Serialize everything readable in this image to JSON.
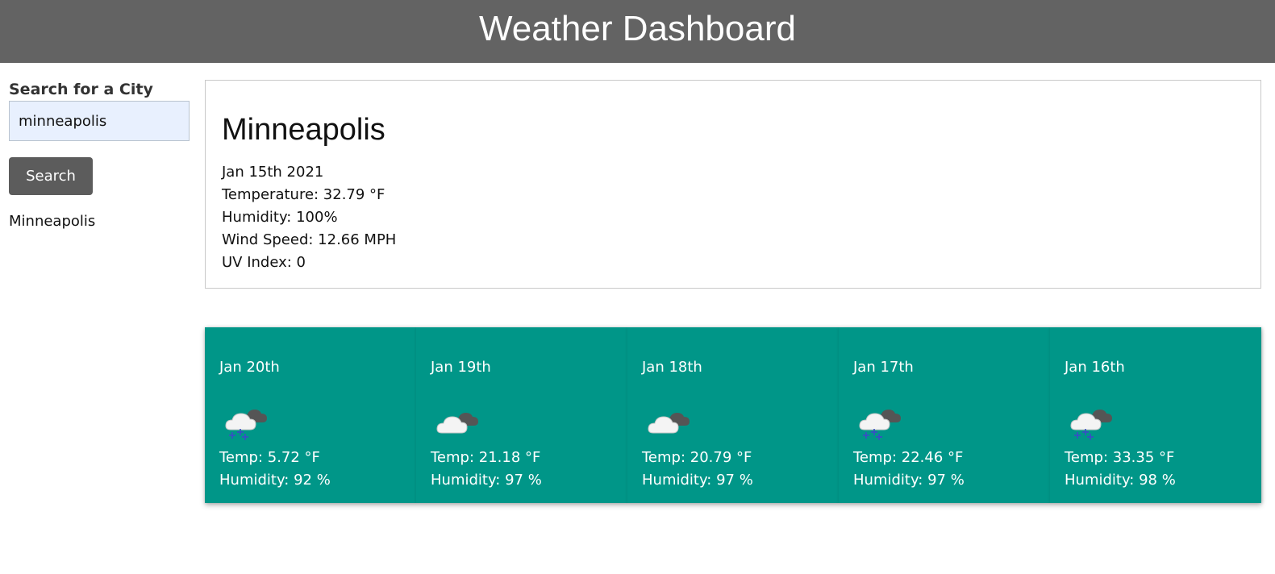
{
  "header": {
    "title": "Weather Dashboard"
  },
  "sidebar": {
    "search_label": "Search for a City",
    "search_value": "minneapolis",
    "search_button": "Search",
    "history": [
      "Minneapolis"
    ]
  },
  "current": {
    "city": "Minneapolis",
    "date": "Jan 15th 2021",
    "temperature": "Temperature: 32.79 °F",
    "humidity": "Humidity: 100%",
    "wind": "Wind Speed: 12.66 MPH",
    "uv": "UV Index: 0"
  },
  "forecast": [
    {
      "date": "Jan 20th",
      "icon": "snow-cloud-icon",
      "temp": "Temp: 5.72 °F",
      "humidity": "Humidity: 92 %"
    },
    {
      "date": "Jan 19th",
      "icon": "broken-clouds-icon",
      "temp": "Temp: 21.18 °F",
      "humidity": "Humidity: 97 %"
    },
    {
      "date": "Jan 18th",
      "icon": "broken-clouds-icon",
      "temp": "Temp: 20.79 °F",
      "humidity": "Humidity: 97 %"
    },
    {
      "date": "Jan 17th",
      "icon": "snow-cloud-icon",
      "temp": "Temp: 22.46 °F",
      "humidity": "Humidity: 97 %"
    },
    {
      "date": "Jan 16th",
      "icon": "snow-cloud-icon",
      "temp": "Temp: 33.35 °F",
      "humidity": "Humidity: 98 %"
    }
  ],
  "colors": {
    "header_bg": "#636363",
    "forecast_bg": "#009688",
    "button_bg": "#5c5c5c",
    "input_bg": "#e8f0fe"
  }
}
